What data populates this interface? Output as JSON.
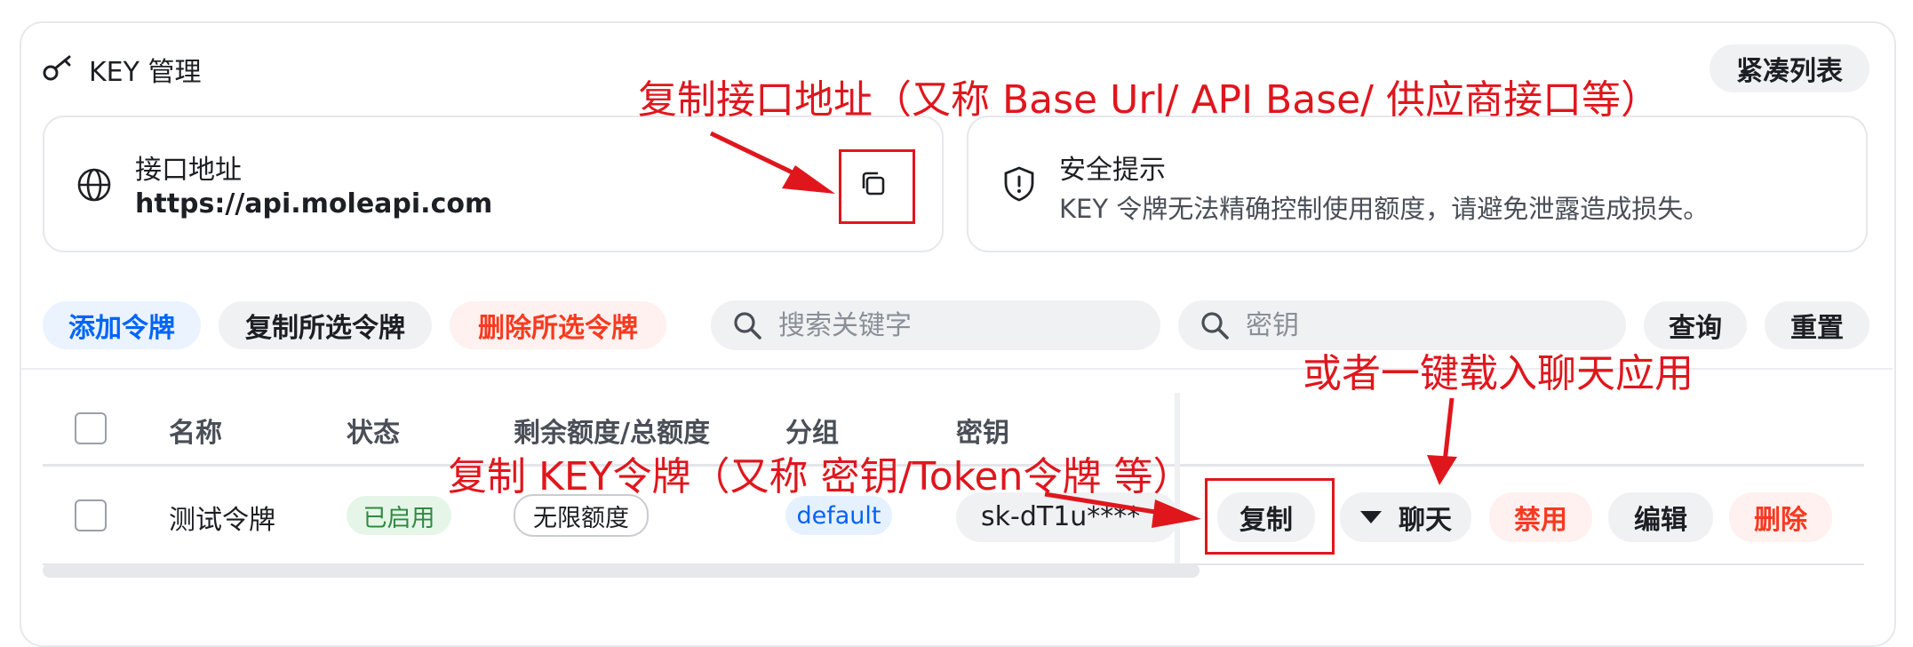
{
  "header": {
    "title": "KEY 管理",
    "compact_label": "紧凑列表"
  },
  "api_card": {
    "label": "接口地址",
    "url": "https://api.moleapi.com"
  },
  "security_card": {
    "label": "安全提示",
    "desc": "KEY 令牌无法精确控制使用额度，请避免泄露造成损失。"
  },
  "toolbar": {
    "add_label": "添加令牌",
    "copy_selected_label": "复制所选令牌",
    "delete_selected_label": "删除所选令牌",
    "search_placeholder": "搜索关键字",
    "key_placeholder": "密钥",
    "query_label": "查询",
    "reset_label": "重置"
  },
  "table": {
    "columns": [
      "名称",
      "状态",
      "剩余额度/总额度",
      "分组",
      "密钥"
    ],
    "rows": [
      {
        "name": "测试令牌",
        "status": "已启用",
        "quota": "无限额度",
        "group": "default",
        "key": "sk-dT1u****",
        "actions": {
          "copy": "复制",
          "chat": "聊天",
          "disable": "禁用",
          "edit": "编辑",
          "delete": "删除"
        }
      }
    ]
  },
  "annotations": {
    "copy_url": "复制接口地址（又称 Base Url/ API Base/ 供应商接口等）",
    "chat": "或者一键载入聊天应用",
    "copy_key": "复制 KEY令牌（又称 密钥/Token令牌 等）"
  },
  "colors": {
    "primary": "#0064fa",
    "danger": "#f93920",
    "annotation": "#e0161d"
  }
}
